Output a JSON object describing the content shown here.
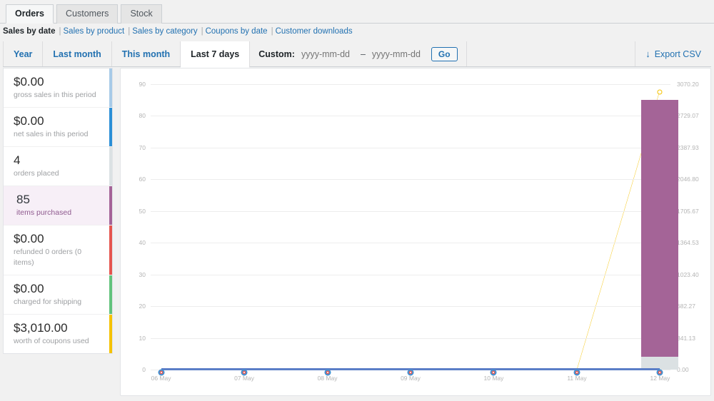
{
  "nav_tabs": [
    {
      "label": "Orders",
      "active": true
    },
    {
      "label": "Customers",
      "active": false
    },
    {
      "label": "Stock",
      "active": false
    }
  ],
  "subnav": [
    {
      "label": "Sales by date",
      "current": true
    },
    {
      "label": "Sales by product",
      "current": false
    },
    {
      "label": "Sales by category",
      "current": false
    },
    {
      "label": "Coupons by date",
      "current": false
    },
    {
      "label": "Customer downloads",
      "current": false
    }
  ],
  "period": {
    "items": [
      {
        "label": "Year",
        "active": false
      },
      {
        "label": "Last month",
        "active": false
      },
      {
        "label": "This month",
        "active": false
      },
      {
        "label": "Last 7 days",
        "active": true
      }
    ],
    "custom_label": "Custom:",
    "from_placeholder": "yyyy-mm-dd",
    "from_value": "",
    "dash": "–",
    "to_placeholder": "yyyy-mm-dd",
    "to_value": "",
    "go_label": "Go",
    "export_label": "Export CSV",
    "export_icon": "download-arrow-icon"
  },
  "stats": [
    {
      "value": "$0.00",
      "label": "gross sales in this period",
      "color": "#a8cbe8",
      "active": false
    },
    {
      "value": "$0.00",
      "label": "net sales in this period",
      "color": "#2b8fd6",
      "active": false
    },
    {
      "value": "4",
      "label": "orders placed",
      "color": "#dbe1e3",
      "active": false
    },
    {
      "value": "85",
      "label": "items purchased",
      "color": "#a46497",
      "active": true
    },
    {
      "value": "$0.00",
      "label": "refunded 0 orders (0 items)",
      "color": "#e5554e",
      "active": false
    },
    {
      "value": "$0.00",
      "label": "charged for shipping",
      "color": "#62c37c",
      "active": false
    },
    {
      "value": "$3,010.00",
      "label": "worth of coupons used",
      "color": "#f5c200",
      "active": false
    }
  ],
  "chart_data": {
    "type": "bar",
    "title": "",
    "xlabel": "",
    "ylabel": "",
    "categories": [
      "06 May",
      "07 May",
      "08 May",
      "09 May",
      "10 May",
      "11 May",
      "12 May"
    ],
    "left_axis": {
      "ticks": [
        0,
        10,
        20,
        30,
        40,
        50,
        60,
        70,
        80,
        90
      ],
      "tick_labels": [
        "0",
        "10",
        "20",
        "30",
        "40",
        "50",
        "60",
        "70",
        "80",
        "90"
      ],
      "ylim": [
        0,
        90
      ]
    },
    "right_axis": {
      "ticks": [
        0,
        341.13,
        682.27,
        1023.4,
        1364.53,
        1705.67,
        2046.8,
        2387.93,
        2729.07,
        3070.2
      ],
      "tick_labels": [
        "0.00",
        "341.13",
        "682.27",
        "1023.40",
        "1364.53",
        "1705.67",
        "2046.80",
        "2387.93",
        "2729.07",
        "3070.20"
      ],
      "ylim": [
        0,
        3070.2
      ]
    },
    "grid": true,
    "legend": "none",
    "series": [
      {
        "name": "items purchased",
        "type": "bar",
        "axis": "left",
        "color": "#a46497",
        "values": [
          0,
          0,
          0,
          0,
          0,
          0,
          85
        ]
      },
      {
        "name": "orders placed",
        "type": "bar",
        "axis": "left",
        "color": "#dbe1e3",
        "values": [
          0,
          0,
          0,
          0,
          0,
          0,
          4
        ]
      },
      {
        "name": "gross sales",
        "type": "line",
        "axis": "right",
        "color": "#5b7ec7",
        "values": [
          0,
          0,
          0,
          0,
          0,
          0,
          0
        ]
      },
      {
        "name": "refunded",
        "type": "line",
        "axis": "right",
        "color": "#e5554e",
        "values": [
          0,
          0,
          0,
          0,
          0,
          0,
          0
        ]
      },
      {
        "name": "coupons used",
        "type": "line",
        "axis": "right",
        "color": "#f5c200",
        "values": [
          0,
          0,
          0,
          0,
          0,
          0,
          3010.0
        ]
      }
    ]
  }
}
